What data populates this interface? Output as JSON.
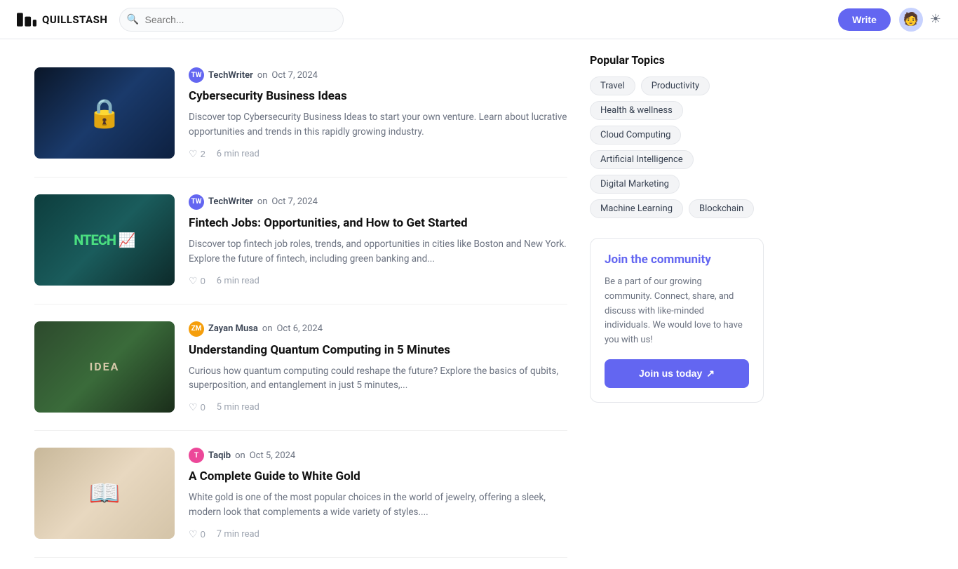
{
  "nav": {
    "logo_text": "QUILLSTASH",
    "search_placeholder": "Search...",
    "write_label": "Write"
  },
  "articles": [
    {
      "id": "cybersecurity",
      "author": "TechWriter",
      "author_initials": "TW",
      "date": "Oct 7, 2024",
      "title": "Cybersecurity Business Ideas",
      "excerpt": "Discover top Cybersecurity Business Ideas to start your own venture. Learn about lucrative opportunities and trends in this rapidly growing industry.",
      "likes": 2,
      "read_time": "6 min read",
      "thumb_type": "cybersecurity"
    },
    {
      "id": "fintech",
      "author": "TechWriter",
      "author_initials": "TW",
      "date": "Oct 7, 2024",
      "title": "Fintech Jobs: Opportunities, and How to Get Started",
      "excerpt": "Discover top fintech job roles, trends, and opportunities in cities like Boston and New York. Explore the future of fintech, including green banking and...",
      "likes": 0,
      "read_time": "6 min read",
      "thumb_type": "fintech"
    },
    {
      "id": "quantum",
      "author": "Zayan Musa",
      "author_initials": "ZM",
      "date": "Oct 6, 2024",
      "title": "Understanding Quantum Computing in 5 Minutes",
      "excerpt": "Curious how quantum computing could reshape the future? Explore the basics of qubits, superposition, and entanglement in just 5 minutes,...",
      "likes": 0,
      "read_time": "5 min read",
      "thumb_type": "quantum"
    },
    {
      "id": "whitegold",
      "author": "Taqib",
      "author_initials": "T",
      "date": "Oct 5, 2024",
      "title": "A Complete Guide to White Gold",
      "excerpt": "White gold is one of the most popular choices in the world of jewelry, offering a sleek, modern look that complements a wide variety of styles....",
      "likes": 0,
      "read_time": "7 min read",
      "thumb_type": "whitegold"
    }
  ],
  "sidebar": {
    "popular_topics_title": "Popular Topics",
    "topics": [
      "Travel",
      "Productivity",
      "Health & wellness",
      "Cloud Computing",
      "Artificial Intelligence",
      "Digital Marketing",
      "Machine Learning",
      "Blockchain"
    ],
    "community": {
      "title": "Join the community",
      "description": "Be a part of our growing community. Connect, share, and discuss with like-minded individuals. We would love to have you with us!",
      "button_label": "Join us today",
      "button_arrow": "↗"
    }
  }
}
